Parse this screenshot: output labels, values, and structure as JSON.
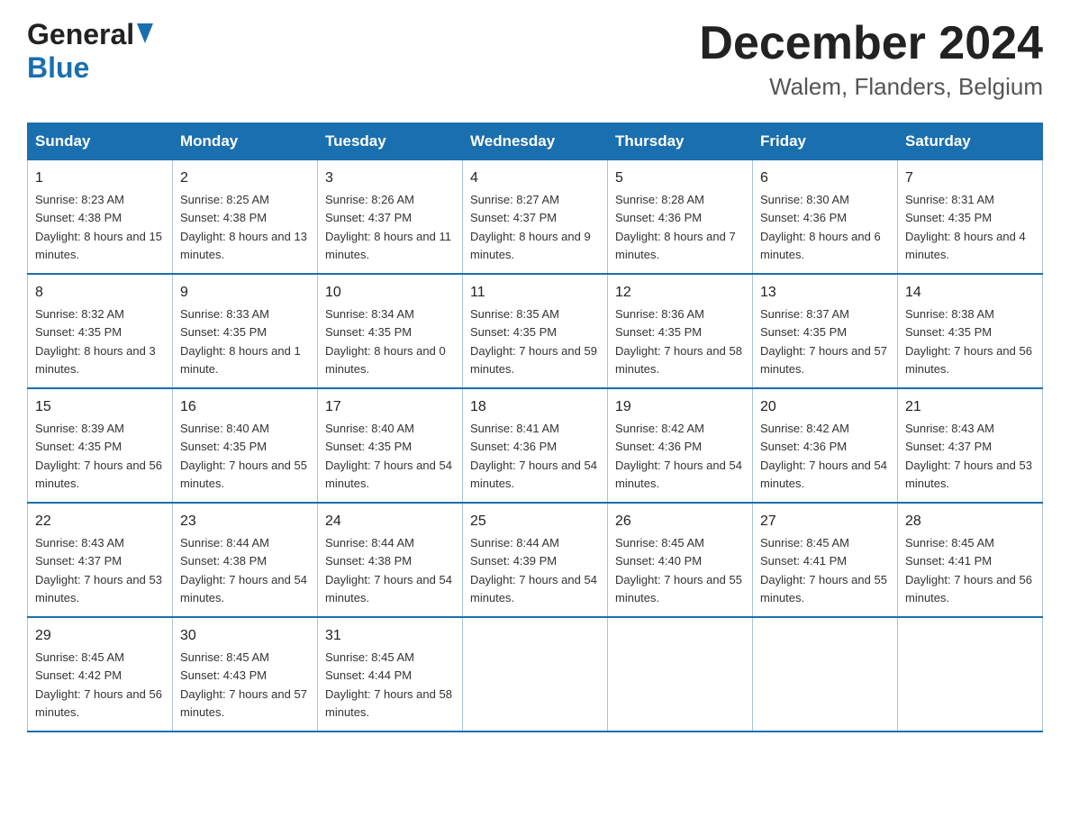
{
  "header": {
    "logo_general": "General",
    "logo_blue": "Blue",
    "month_title": "December 2024",
    "location": "Walem, Flanders, Belgium"
  },
  "calendar": {
    "headers": [
      "Sunday",
      "Monday",
      "Tuesday",
      "Wednesday",
      "Thursday",
      "Friday",
      "Saturday"
    ],
    "weeks": [
      [
        {
          "day": "1",
          "sunrise": "8:23 AM",
          "sunset": "4:38 PM",
          "daylight": "8 hours and 15 minutes."
        },
        {
          "day": "2",
          "sunrise": "8:25 AM",
          "sunset": "4:38 PM",
          "daylight": "8 hours and 13 minutes."
        },
        {
          "day": "3",
          "sunrise": "8:26 AM",
          "sunset": "4:37 PM",
          "daylight": "8 hours and 11 minutes."
        },
        {
          "day": "4",
          "sunrise": "8:27 AM",
          "sunset": "4:37 PM",
          "daylight": "8 hours and 9 minutes."
        },
        {
          "day": "5",
          "sunrise": "8:28 AM",
          "sunset": "4:36 PM",
          "daylight": "8 hours and 7 minutes."
        },
        {
          "day": "6",
          "sunrise": "8:30 AM",
          "sunset": "4:36 PM",
          "daylight": "8 hours and 6 minutes."
        },
        {
          "day": "7",
          "sunrise": "8:31 AM",
          "sunset": "4:35 PM",
          "daylight": "8 hours and 4 minutes."
        }
      ],
      [
        {
          "day": "8",
          "sunrise": "8:32 AM",
          "sunset": "4:35 PM",
          "daylight": "8 hours and 3 minutes."
        },
        {
          "day": "9",
          "sunrise": "8:33 AM",
          "sunset": "4:35 PM",
          "daylight": "8 hours and 1 minute."
        },
        {
          "day": "10",
          "sunrise": "8:34 AM",
          "sunset": "4:35 PM",
          "daylight": "8 hours and 0 minutes."
        },
        {
          "day": "11",
          "sunrise": "8:35 AM",
          "sunset": "4:35 PM",
          "daylight": "7 hours and 59 minutes."
        },
        {
          "day": "12",
          "sunrise": "8:36 AM",
          "sunset": "4:35 PM",
          "daylight": "7 hours and 58 minutes."
        },
        {
          "day": "13",
          "sunrise": "8:37 AM",
          "sunset": "4:35 PM",
          "daylight": "7 hours and 57 minutes."
        },
        {
          "day": "14",
          "sunrise": "8:38 AM",
          "sunset": "4:35 PM",
          "daylight": "7 hours and 56 minutes."
        }
      ],
      [
        {
          "day": "15",
          "sunrise": "8:39 AM",
          "sunset": "4:35 PM",
          "daylight": "7 hours and 56 minutes."
        },
        {
          "day": "16",
          "sunrise": "8:40 AM",
          "sunset": "4:35 PM",
          "daylight": "7 hours and 55 minutes."
        },
        {
          "day": "17",
          "sunrise": "8:40 AM",
          "sunset": "4:35 PM",
          "daylight": "7 hours and 54 minutes."
        },
        {
          "day": "18",
          "sunrise": "8:41 AM",
          "sunset": "4:36 PM",
          "daylight": "7 hours and 54 minutes."
        },
        {
          "day": "19",
          "sunrise": "8:42 AM",
          "sunset": "4:36 PM",
          "daylight": "7 hours and 54 minutes."
        },
        {
          "day": "20",
          "sunrise": "8:42 AM",
          "sunset": "4:36 PM",
          "daylight": "7 hours and 54 minutes."
        },
        {
          "day": "21",
          "sunrise": "8:43 AM",
          "sunset": "4:37 PM",
          "daylight": "7 hours and 53 minutes."
        }
      ],
      [
        {
          "day": "22",
          "sunrise": "8:43 AM",
          "sunset": "4:37 PM",
          "daylight": "7 hours and 53 minutes."
        },
        {
          "day": "23",
          "sunrise": "8:44 AM",
          "sunset": "4:38 PM",
          "daylight": "7 hours and 54 minutes."
        },
        {
          "day": "24",
          "sunrise": "8:44 AM",
          "sunset": "4:38 PM",
          "daylight": "7 hours and 54 minutes."
        },
        {
          "day": "25",
          "sunrise": "8:44 AM",
          "sunset": "4:39 PM",
          "daylight": "7 hours and 54 minutes."
        },
        {
          "day": "26",
          "sunrise": "8:45 AM",
          "sunset": "4:40 PM",
          "daylight": "7 hours and 55 minutes."
        },
        {
          "day": "27",
          "sunrise": "8:45 AM",
          "sunset": "4:41 PM",
          "daylight": "7 hours and 55 minutes."
        },
        {
          "day": "28",
          "sunrise": "8:45 AM",
          "sunset": "4:41 PM",
          "daylight": "7 hours and 56 minutes."
        }
      ],
      [
        {
          "day": "29",
          "sunrise": "8:45 AM",
          "sunset": "4:42 PM",
          "daylight": "7 hours and 56 minutes."
        },
        {
          "day": "30",
          "sunrise": "8:45 AM",
          "sunset": "4:43 PM",
          "daylight": "7 hours and 57 minutes."
        },
        {
          "day": "31",
          "sunrise": "8:45 AM",
          "sunset": "4:44 PM",
          "daylight": "7 hours and 58 minutes."
        },
        null,
        null,
        null,
        null
      ]
    ]
  }
}
